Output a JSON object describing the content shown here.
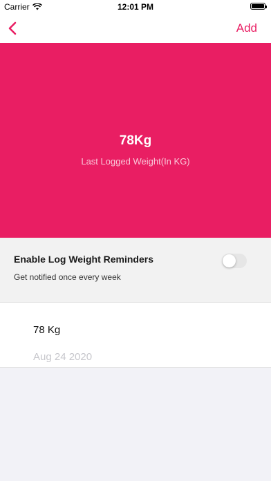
{
  "status_bar": {
    "carrier": "Carrier",
    "time": "12:01 PM"
  },
  "nav": {
    "back_icon": "chevron-left-icon",
    "add_label": "Add",
    "accent_color": "#e91e63"
  },
  "hero": {
    "value": "78Kg",
    "caption": "Last Logged Weight(In KG)",
    "background_color": "#e91e63"
  },
  "reminder": {
    "title": "Enable Log Weight Reminders",
    "subtitle": "Get notified once every week",
    "enabled": false
  },
  "log_entries": [
    {
      "value": "78 Kg",
      "date": "Aug 24 2020"
    }
  ]
}
